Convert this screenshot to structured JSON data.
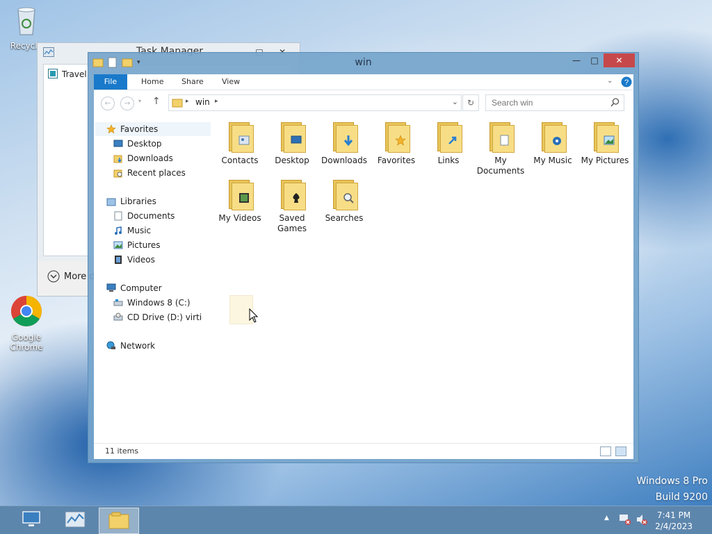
{
  "desktop": {
    "recycle_label": "Recycle",
    "chrome_label_1": "Google",
    "chrome_label_2": "Chrome",
    "watermark_line1": "Windows 8 Pro",
    "watermark_line2": "Build 9200"
  },
  "task_manager": {
    "title": "Task Manager",
    "item": "Travel",
    "more_details": "More details"
  },
  "explorer": {
    "title": "win",
    "tabs": [
      "File",
      "Home",
      "Share",
      "View"
    ],
    "address": "win",
    "search_placeholder": "Search win",
    "nav": {
      "favorites": "Favorites",
      "desktop": "Desktop",
      "downloads": "Downloads",
      "recent": "Recent places",
      "libraries": "Libraries",
      "documents": "Documents",
      "music": "Music",
      "pictures": "Pictures",
      "videos": "Videos",
      "computer": "Computer",
      "drive_c": "Windows 8 (C:)",
      "drive_d": "CD Drive (D:) virtio-√",
      "network": "Network"
    },
    "folders": [
      {
        "line1": "Contacts",
        "line2": ""
      },
      {
        "line1": "Desktop",
        "line2": ""
      },
      {
        "line1": "Downloads",
        "line2": ""
      },
      {
        "line1": "Favorites",
        "line2": ""
      },
      {
        "line1": "Links",
        "line2": ""
      },
      {
        "line1": "My",
        "line2": "Documents"
      },
      {
        "line1": "My Music",
        "line2": ""
      },
      {
        "line1": "My Pictures",
        "line2": ""
      },
      {
        "line1": "My Videos",
        "line2": ""
      },
      {
        "line1": "Saved",
        "line2": "Games"
      },
      {
        "line1": "Searches",
        "line2": ""
      }
    ],
    "status": "11 items"
  },
  "taskbar": {
    "time": "7:41 PM",
    "date": "2/4/2023"
  },
  "colors": {
    "accent": "#1979ca",
    "close": "#c7484a",
    "taskbar": "#5d86ad"
  }
}
